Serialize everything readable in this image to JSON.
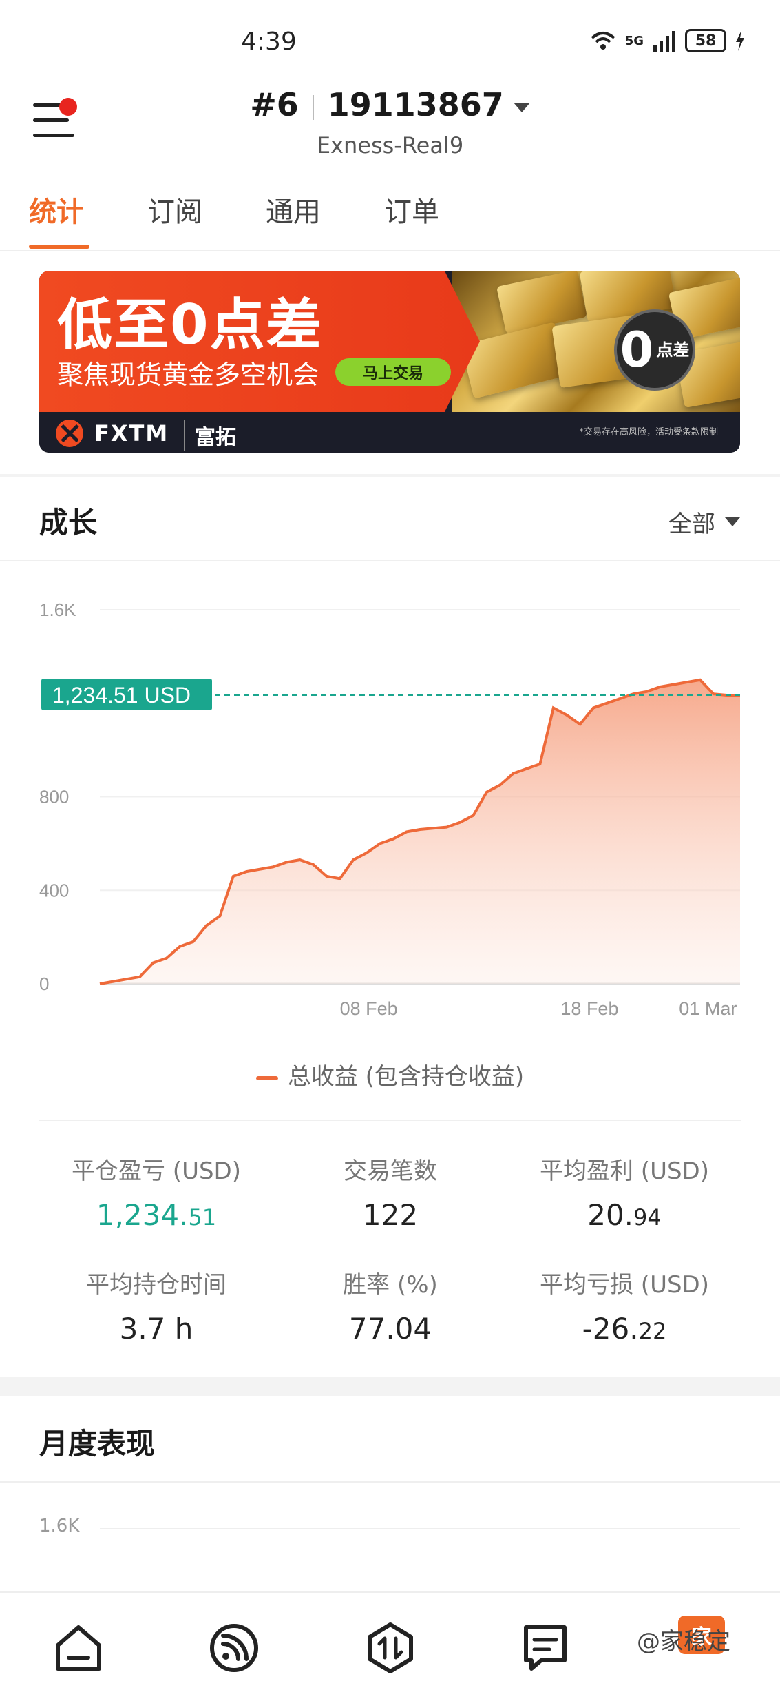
{
  "status_bar": {
    "time": "4:39",
    "network": "5G",
    "battery": "58"
  },
  "header": {
    "account_num": "#6",
    "account_id": "19113867",
    "server": "Exness-Real9"
  },
  "tabs": [
    {
      "label": "统计",
      "active": true
    },
    {
      "label": "订阅",
      "active": false
    },
    {
      "label": "通用",
      "active": false
    },
    {
      "label": "订单",
      "active": false
    }
  ],
  "banner": {
    "title": "低至0点差",
    "subtitle": "聚焦现货黄金多空机会",
    "button": "马上交易",
    "badge_big": "0",
    "badge_small": "点差",
    "brand": "FXTM",
    "brand_cn": "富拓",
    "disclaimer": "*交易存在高风险，活动受条款限制"
  },
  "growth": {
    "title": "成长",
    "range": "全部",
    "legend": "总收益 (包含持仓收益)"
  },
  "chart_data": {
    "type": "area",
    "ylim": [
      0,
      1600
    ],
    "yticks": [
      "0",
      "400",
      "800",
      "1.6K"
    ],
    "ytick_values": [
      0,
      400,
      800,
      1600
    ],
    "xticks": [
      "08 Feb",
      "18 Feb",
      "01 Mar"
    ],
    "current_label": "1,234.51 USD",
    "current_value": 1234.51,
    "series": [
      {
        "name": "总收益 (包含持仓收益)",
        "color": "#ee6a3a",
        "values": [
          0,
          10,
          20,
          30,
          90,
          110,
          160,
          180,
          250,
          290,
          460,
          480,
          490,
          500,
          520,
          530,
          510,
          460,
          450,
          530,
          560,
          600,
          620,
          650,
          660,
          665,
          670,
          690,
          720,
          820,
          850,
          900,
          920,
          940,
          1180,
          1150,
          1110,
          1180,
          1200,
          1220,
          1240,
          1250,
          1270,
          1280,
          1290,
          1300,
          1240,
          1234.51,
          1234.51
        ]
      }
    ]
  },
  "stats": {
    "closed_pl": {
      "label": "平仓盈亏 (USD)",
      "int": "1,234.",
      "dec": "51"
    },
    "trades": {
      "label": "交易笔数",
      "int": "122",
      "dec": ""
    },
    "avg_profit": {
      "label": "平均盈利 (USD)",
      "int": "20.",
      "dec": "94"
    },
    "avg_hold": {
      "label": "平均持仓时间",
      "int": "3.7 h",
      "dec": ""
    },
    "win_rate": {
      "label": "胜率 (%)",
      "int": "77.04",
      "dec": ""
    },
    "avg_loss": {
      "label": "平均亏损 (USD)",
      "int": "-26.",
      "dec": "22"
    }
  },
  "monthly": {
    "title": "月度表现",
    "ytick_top": "1.6K"
  },
  "nav": [
    "home-icon",
    "feed-icon",
    "trade-icon",
    "orders-icon"
  ],
  "watermark": {
    "text": "@家稳定",
    "badge": "家"
  }
}
